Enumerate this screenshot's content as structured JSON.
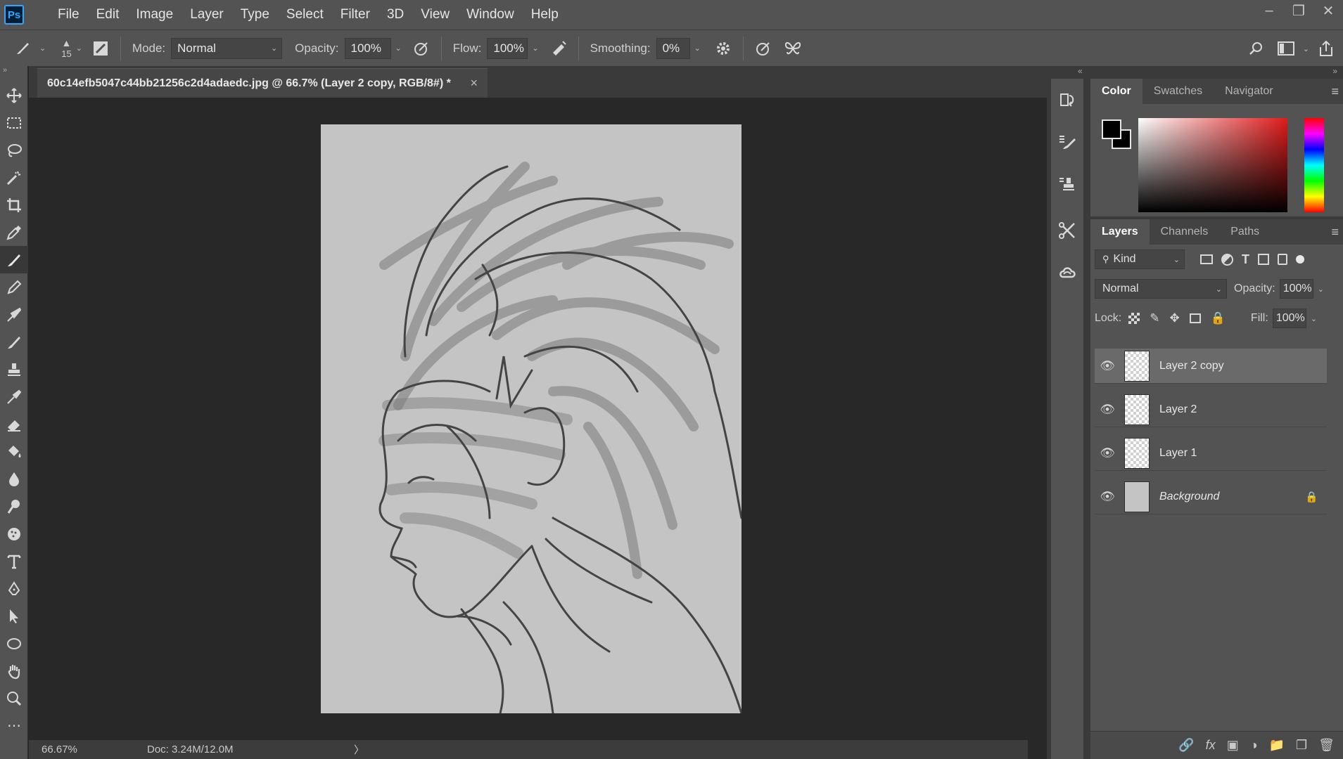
{
  "app": {
    "logo_text": "Ps"
  },
  "menu": [
    "File",
    "Edit",
    "Image",
    "Layer",
    "Type",
    "Select",
    "Filter",
    "3D",
    "View",
    "Window",
    "Help"
  ],
  "options": {
    "brush_size": "15",
    "mode_label": "Mode:",
    "mode_value": "Normal",
    "opacity_label": "Opacity:",
    "opacity_value": "100%",
    "flow_label": "Flow:",
    "flow_value": "100%",
    "smoothing_label": "Smoothing:",
    "smoothing_value": "0%"
  },
  "document": {
    "tab_title": "60c14efb5047c44bb21256c2d4adaedc.jpg @ 66.7% (Layer 2 copy, RGB/8#) *",
    "close": "×"
  },
  "status": {
    "zoom": "66.67%",
    "doc": "Doc: 3.24M/12.0M",
    "arrow": "〉"
  },
  "color_panel": {
    "tabs": [
      "Color",
      "Swatches",
      "Navigator"
    ],
    "foreground": "#000000",
    "background": "#000000"
  },
  "layers_panel": {
    "tabs": [
      "Layers",
      "Channels",
      "Paths"
    ],
    "filter_kind": "Kind",
    "blend_mode": "Normal",
    "opacity_label": "Opacity:",
    "opacity_value": "100%",
    "lock_label": "Lock:",
    "fill_label": "Fill:",
    "fill_value": "100%",
    "layers": [
      {
        "name": "Layer 2 copy",
        "selected": true
      },
      {
        "name": "Layer 2",
        "selected": false
      },
      {
        "name": "Layer 1",
        "selected": false
      },
      {
        "name": "Background",
        "selected": false,
        "locked": true
      }
    ]
  },
  "colors": {
    "accent": "#31a8ff",
    "ui_bg": "#535353",
    "canvas_bg": "#282828"
  }
}
